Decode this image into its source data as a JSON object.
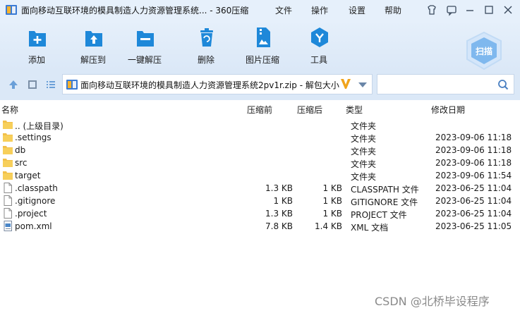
{
  "window": {
    "title": "面向移动互联环境的模具制造人力资源管理系统... - 360压缩",
    "menu": [
      "文件",
      "操作",
      "设置",
      "帮助"
    ]
  },
  "toolbar": {
    "items": [
      {
        "label": "添加",
        "icon": "add-archive-icon"
      },
      {
        "label": "解压到",
        "icon": "extract-to-icon"
      },
      {
        "label": "一键解压",
        "icon": "one-click-extract-icon"
      },
      {
        "label": "删除",
        "icon": "delete-icon"
      },
      {
        "label": "图片压缩",
        "icon": "image-compress-icon"
      },
      {
        "label": "工具",
        "icon": "tools-icon"
      }
    ],
    "scan_label": "扫描"
  },
  "address": {
    "path": "面向移动互联环境的模具制造人力资源管理系统2pv1r.zip - 解包大小",
    "search_placeholder": ""
  },
  "columns": {
    "name": "名称",
    "before": "压缩前",
    "after": "压缩后",
    "type": "类型",
    "modified": "修改日期"
  },
  "files": [
    {
      "name": ".. (上级目录)",
      "before": "",
      "after": "",
      "type": "文件夹",
      "modified": "",
      "icon": "folder-icon"
    },
    {
      "name": ".settings",
      "before": "",
      "after": "",
      "type": "文件夹",
      "modified": "2023-09-06 11:18",
      "icon": "folder-icon"
    },
    {
      "name": "db",
      "before": "",
      "after": "",
      "type": "文件夹",
      "modified": "2023-09-06 11:18",
      "icon": "folder-icon"
    },
    {
      "name": "src",
      "before": "",
      "after": "",
      "type": "文件夹",
      "modified": "2023-09-06 11:18",
      "icon": "folder-icon"
    },
    {
      "name": "target",
      "before": "",
      "after": "",
      "type": "文件夹",
      "modified": "2023-09-06 11:54",
      "icon": "folder-icon"
    },
    {
      "name": ".classpath",
      "before": "1.3 KB",
      "after": "1 KB",
      "type": "CLASSPATH 文件",
      "modified": "2023-06-25 11:04",
      "icon": "file-icon"
    },
    {
      "name": ".gitignore",
      "before": "1 KB",
      "after": "1 KB",
      "type": "GITIGNORE 文件",
      "modified": "2023-06-25 11:04",
      "icon": "file-icon"
    },
    {
      "name": ".project",
      "before": "1.3 KB",
      "after": "1 KB",
      "type": "PROJECT 文件",
      "modified": "2023-06-25 11:04",
      "icon": "file-icon"
    },
    {
      "name": "pom.xml",
      "before": "7.8 KB",
      "after": "1.4 KB",
      "type": "XML 文档",
      "modified": "2023-06-25 11:05",
      "icon": "xml-file-icon"
    }
  ],
  "watermark": "CSDN @北桥毕设程序",
  "colors": {
    "accent": "#1e88d9",
    "titlebar": "#e6f0fb",
    "folder": "#f2c04a"
  }
}
